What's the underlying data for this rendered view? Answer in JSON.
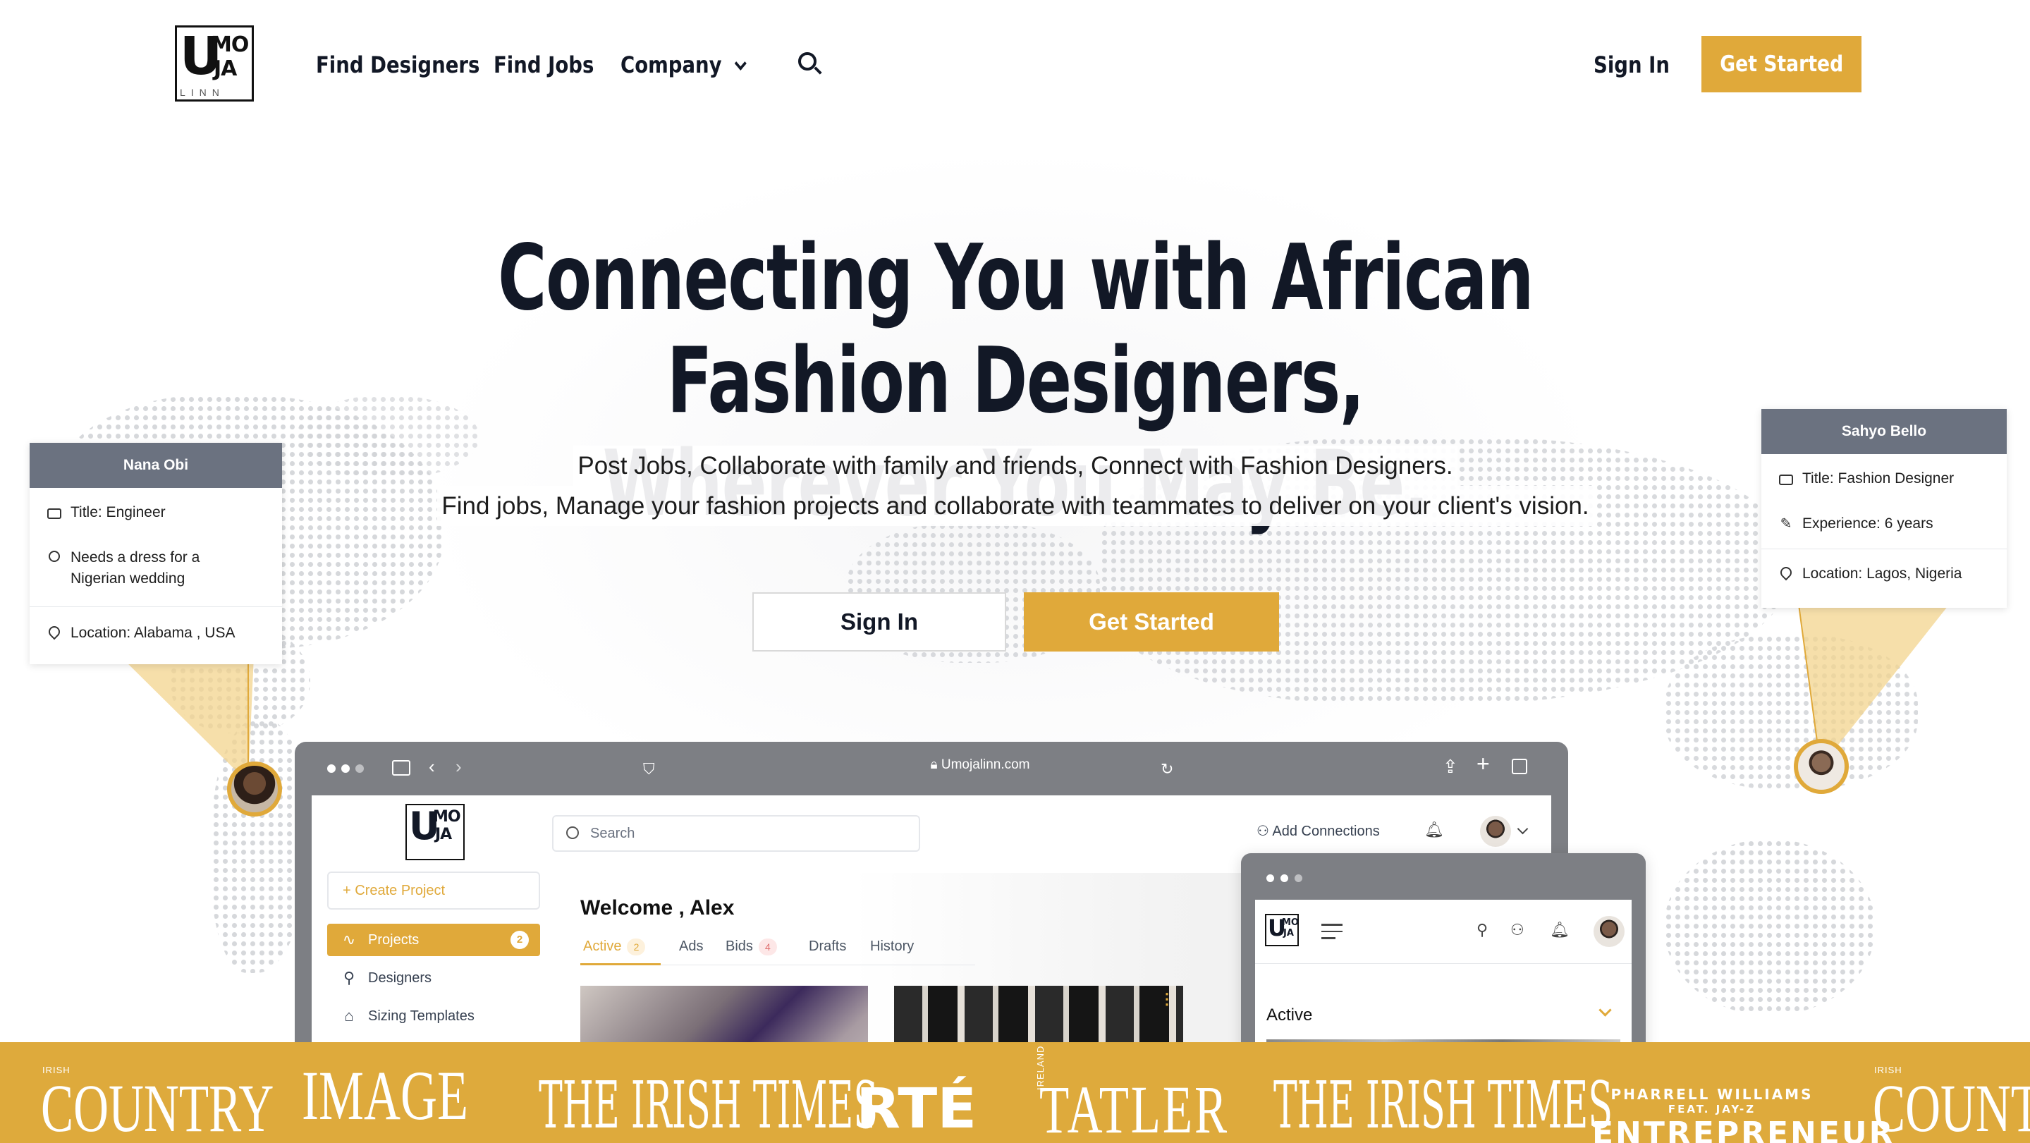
{
  "brand": {
    "logo_mark_u": "U",
    "logo_mark_mo": "MO",
    "logo_mark_ja": "JA",
    "logo_wordmark": "LINN",
    "accent_color": "#e0a93a",
    "text_color": "#121826",
    "card_header_color": "#6b7280"
  },
  "nav": {
    "links": [
      {
        "label": "Find Designers"
      },
      {
        "label": "Find Jobs"
      },
      {
        "label": "Company"
      }
    ],
    "search_icon": "search-icon",
    "sign_in": "Sign In",
    "get_started": "Get Started"
  },
  "hero": {
    "title_line1": "Connecting You with African Fashion Designers,",
    "title_line2": "Wherever You May Be.",
    "sub_line1": "Post Jobs, Collaborate with family and friends, Connect with Fashion Designers.",
    "sub_line2": "Find jobs, Manage your fashion projects and collaborate with teammates to deliver on your client's vision.",
    "sign_in": "Sign In",
    "get_started": "Get Started"
  },
  "profile_left": {
    "name": "Nana Obi",
    "title": "Title: Engineer",
    "need_line1": "Needs a dress for a",
    "need_line2": "Nigerian wedding",
    "location": "Location: Alabama , USA"
  },
  "profile_right": {
    "name": "Sahyo Bello",
    "title": "Title: Fashion Designer",
    "experience": "Experience: 6 years",
    "location": "Location: Lagos, Nigeria"
  },
  "browser": {
    "url": "Umojalinn.com",
    "sidebar": {
      "create_project": "Create Project",
      "items": [
        {
          "label": "Projects",
          "badge": "2",
          "icon": "pulse-icon"
        },
        {
          "label": "Designers",
          "icon": "search-icon"
        },
        {
          "label": "Sizing Templates",
          "icon": "tag-icon"
        }
      ]
    },
    "search_placeholder": "Search",
    "add_connections": "Add Connections",
    "welcome": "Welcome , Alex",
    "tabs": [
      {
        "label": "Active",
        "badge": "2"
      },
      {
        "label": "Ads"
      },
      {
        "label": "Bids",
        "badge": "4"
      },
      {
        "label": "Drafts"
      },
      {
        "label": "History"
      }
    ]
  },
  "mobile": {
    "section_title": "Active"
  },
  "press": {
    "logos": [
      {
        "small": "IRISH",
        "name": "COUNTRY"
      },
      {
        "name": "IMAGE"
      },
      {
        "name": "THE IRISH TIMES"
      },
      {
        "name": "RTÉ"
      },
      {
        "small": "IRELAND",
        "name": "TATLER"
      },
      {
        "name": "THE IRISH TIMES"
      },
      {
        "small": "PHARRELL WILLIAMS",
        "small2": "FEAT. JAY-Z",
        "name": "ENTREPRENEUR"
      },
      {
        "small": "IRISH",
        "name": "COUNTRY"
      }
    ]
  }
}
